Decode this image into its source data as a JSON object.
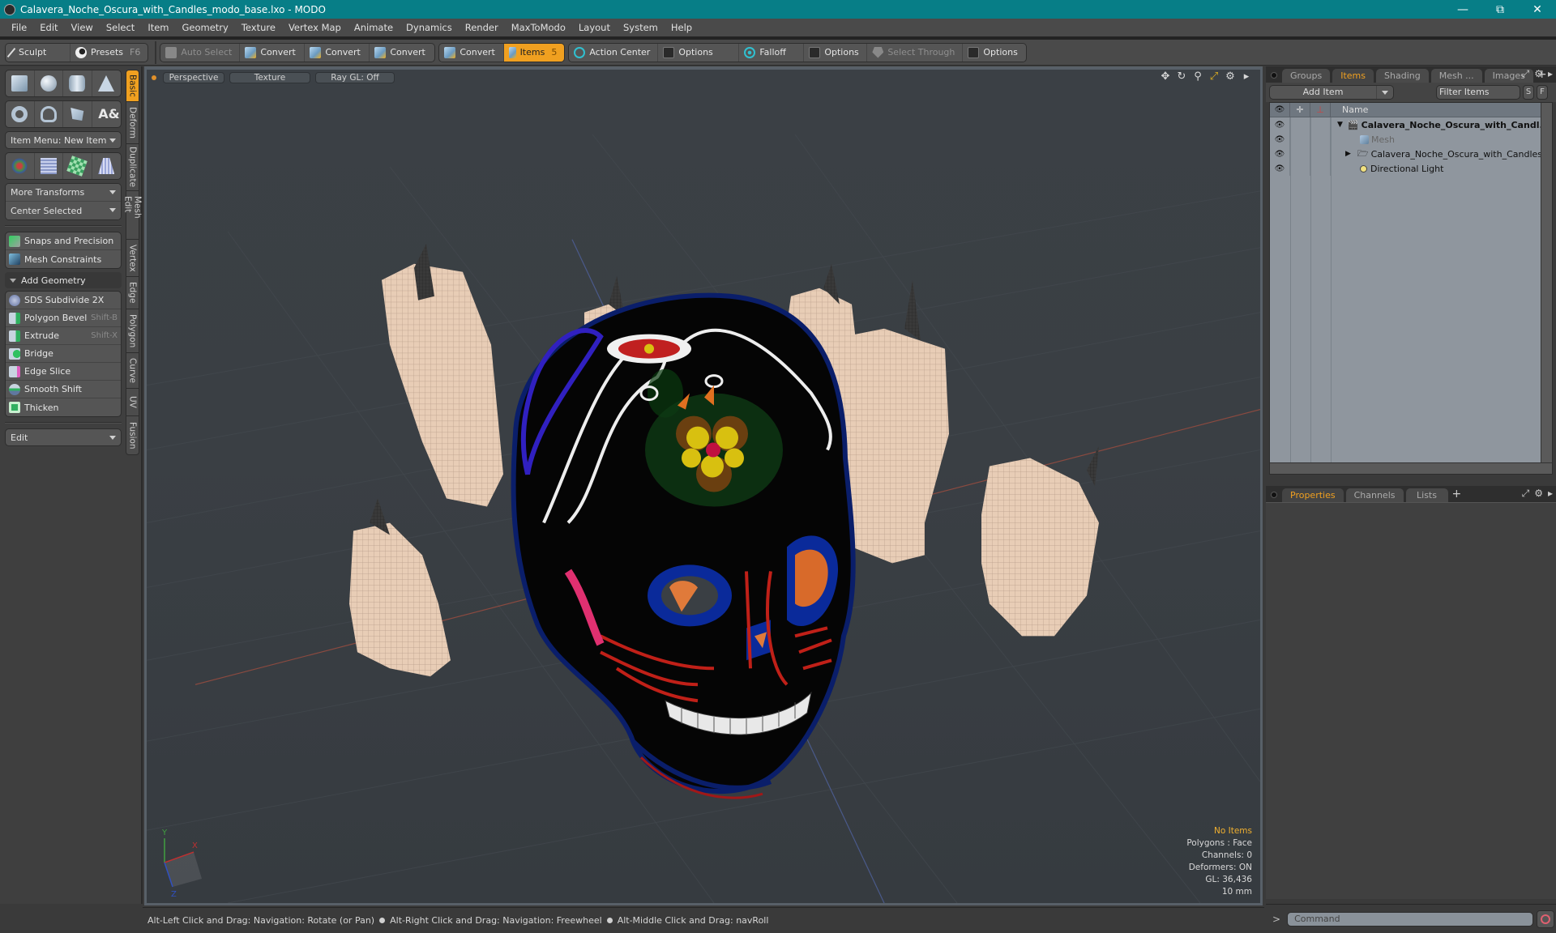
{
  "window": {
    "title": "Calavera_Noche_Oscura_with_Candles_modo_base.lxo - MODO",
    "controls": [
      "minimize",
      "restore",
      "close"
    ]
  },
  "menu": [
    "File",
    "Edit",
    "View",
    "Select",
    "Item",
    "Geometry",
    "Texture",
    "Vertex Map",
    "Animate",
    "Dynamics",
    "Render",
    "MaxToModo",
    "Layout",
    "System",
    "Help"
  ],
  "toolbar": {
    "sculpt": "Sculpt",
    "presets": "Presets",
    "presets_key": "F6",
    "auto_select": "Auto Select",
    "convert1": "Convert",
    "convert2": "Convert",
    "convert3": "Convert",
    "convert4": "Convert",
    "items": "Items",
    "items_key": "5",
    "action_center": "Action Center",
    "options1": "Options",
    "falloff": "Falloff",
    "options2": "Options",
    "select_through": "Select Through",
    "options3": "Options"
  },
  "left": {
    "item_menu": "Item Menu: New Item",
    "more_transforms": "More Transforms",
    "center_selected": "Center Selected",
    "snaps": "Snaps and Precision",
    "constraints": "Mesh Constraints",
    "add_geometry": "Add Geometry",
    "tools": [
      {
        "label": "SDS Subdivide 2X",
        "key": ""
      },
      {
        "label": "Polygon Bevel",
        "key": "Shift-B"
      },
      {
        "label": "Extrude",
        "key": "Shift-X"
      },
      {
        "label": "Bridge",
        "key": ""
      },
      {
        "label": "Edge Slice",
        "key": ""
      },
      {
        "label": "Smooth Shift",
        "key": ""
      },
      {
        "label": "Thicken",
        "key": ""
      }
    ],
    "edit": "Edit",
    "vtabs": [
      "Basic",
      "Deform",
      "Duplicate",
      "Mesh Edit",
      "Vertex",
      "Edge",
      "Polygon",
      "Curve",
      "UV",
      "Fusion"
    ]
  },
  "viewport": {
    "view": "Perspective",
    "shading": "Texture",
    "raygl": "Ray GL: Off",
    "info": {
      "selection": "No Items",
      "polygons": "Polygons : Face",
      "channels": "Channels: 0",
      "deformers": "Deformers: ON",
      "gl": "GL: 36,436",
      "unit": "10 mm"
    },
    "axis": {
      "x": "X",
      "y": "Y",
      "z": "Z"
    }
  },
  "status": {
    "hint1": "Alt-Left Click and Drag: Navigation: Rotate (or Pan)",
    "hint2": "Alt-Right Click and Drag: Navigation: Freewheel",
    "hint3": "Alt-Middle Click and Drag: navRoll"
  },
  "right": {
    "tabs": [
      "Groups",
      "Items",
      "Shading",
      "Mesh ...",
      "Images"
    ],
    "active_tab": "Items",
    "add_item": "Add Item",
    "filter_placeholder": "Filter Items",
    "s_btn": "S",
    "f_btn": "F",
    "col_name": "Name",
    "items": [
      {
        "name": "Calavera_Noche_Oscura_with_Candl...",
        "type": "scene",
        "level": 0
      },
      {
        "name": "Mesh",
        "type": "mesh",
        "level": 1
      },
      {
        "name": "Calavera_Noche_Oscura_with_Candles",
        "type": "group",
        "level": 1
      },
      {
        "name": "Directional Light",
        "type": "light",
        "level": 1
      }
    ],
    "bottom_tabs": [
      "Properties",
      "Channels",
      "Lists"
    ],
    "bottom_active": "Properties",
    "command_placeholder": "Command"
  },
  "colors": {
    "title_bar": "#077e87",
    "accent": "#f0a020",
    "info_highlight": "#f0b030"
  }
}
